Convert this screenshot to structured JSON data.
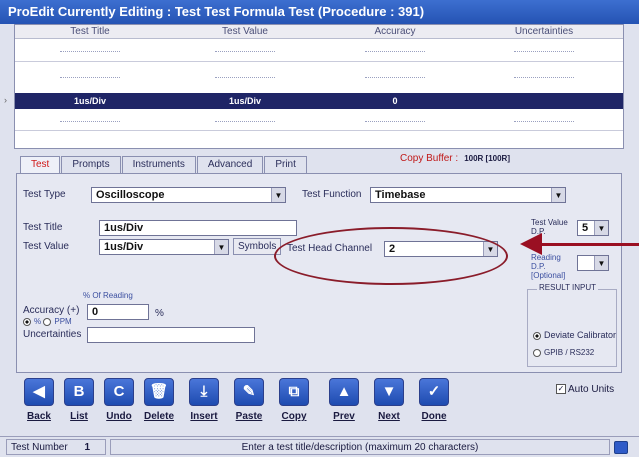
{
  "title": "ProEdit Currently Editing : Test Test Formula Test (Procedure : 391)",
  "grid": {
    "columns": [
      "Test Title",
      "Test Value",
      "Accuracy",
      "Uncertainties"
    ],
    "selected_row": {
      "title": "1us/Div",
      "value": "1us/Div",
      "accuracy": "0",
      "uncertainties": ""
    }
  },
  "tabs": [
    "Test",
    "Prompts",
    "Instruments",
    "Advanced",
    "Print"
  ],
  "copy_buffer": {
    "label": "Copy Buffer :",
    "value": "100R [100R]"
  },
  "form": {
    "test_type_label": "Test Type",
    "test_type_value": "Oscilloscope",
    "test_function_label": "Test Function",
    "test_function_value": "Timebase",
    "test_title_label": "Test Title",
    "test_title_value": "1us/Div",
    "test_value_label": "Test Value",
    "test_value_value": "1us/Div",
    "symbols_label": "Symbols",
    "head_channel_label": "Test Head Channel",
    "head_channel_value": "2",
    "test_value_dp_label": "Test Value D.P.",
    "test_value_dp_value": "5",
    "reading_dp_label": "Reading D.P. [Optional]",
    "result_input_label": "RESULT INPUT",
    "accuracy_label": "Accuracy (+)",
    "pct_reading_label": "% Of Reading",
    "accuracy_value": "0",
    "accuracy_unit": "%",
    "radio_pct": "%",
    "radio_ppm": "PPM",
    "uncertainties_label": "Uncertainties",
    "deviate_label": "Deviate Calibrator",
    "gpib_label": "GPIB / RS232"
  },
  "toolbar": [
    {
      "label": "Back",
      "icon": "back-icon",
      "glyph": "◀"
    },
    {
      "label": "List",
      "icon": "list-icon",
      "glyph": "B"
    },
    {
      "label": "Undo",
      "icon": "undo-icon",
      "glyph": "C"
    },
    {
      "label": "Delete",
      "icon": "delete-icon",
      "glyph": "🗑"
    },
    {
      "label": "Insert",
      "icon": "insert-icon",
      "glyph": "⤓"
    },
    {
      "label": "Paste",
      "icon": "paste-icon",
      "glyph": "✎"
    },
    {
      "label": "Copy",
      "icon": "copy-icon",
      "glyph": "⧉"
    },
    {
      "label": "Prev",
      "icon": "prev-icon",
      "glyph": "▲"
    },
    {
      "label": "Next",
      "icon": "next-icon",
      "glyph": "▼"
    },
    {
      "label": "Done",
      "icon": "done-icon",
      "glyph": "✓"
    }
  ],
  "auto_units_label": "Auto Units",
  "status": {
    "test_number_label": "Test Number",
    "test_number_value": "1",
    "message": "Enter a test title/description (maximum 20 characters)"
  }
}
